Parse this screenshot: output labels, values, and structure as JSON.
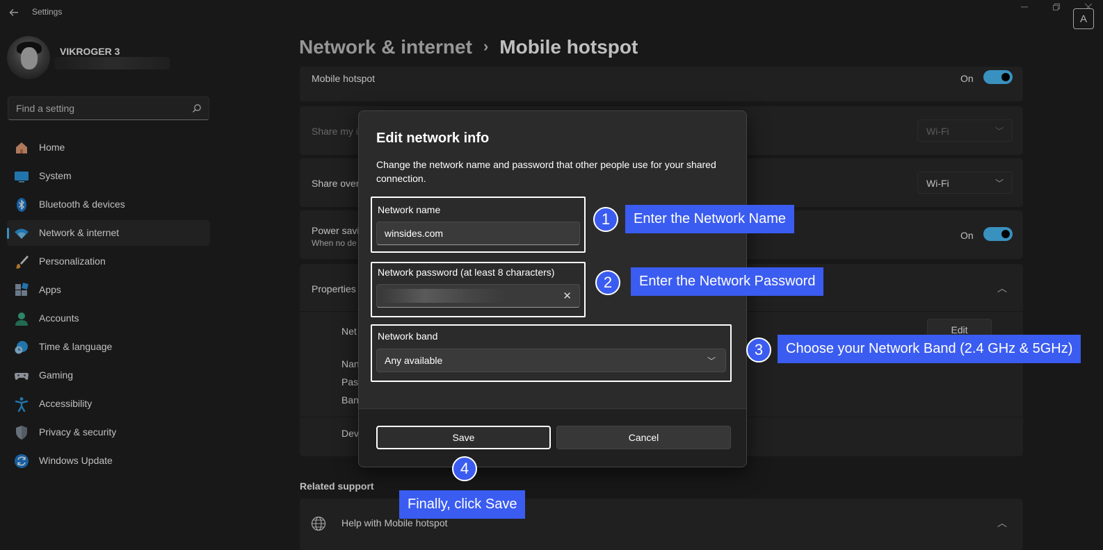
{
  "window": {
    "title": "Settings",
    "ocr_icon_label": "A"
  },
  "user": {
    "name": "VIKROGER 3"
  },
  "search": {
    "placeholder": "Find a setting"
  },
  "sidebar": {
    "items": [
      {
        "label": "Home",
        "icon": "home-icon"
      },
      {
        "label": "System",
        "icon": "system-icon"
      },
      {
        "label": "Bluetooth & devices",
        "icon": "bluetooth-icon"
      },
      {
        "label": "Network & internet",
        "icon": "wifi-icon",
        "active": true
      },
      {
        "label": "Personalization",
        "icon": "brush-icon"
      },
      {
        "label": "Apps",
        "icon": "apps-icon"
      },
      {
        "label": "Accounts",
        "icon": "accounts-icon"
      },
      {
        "label": "Time & language",
        "icon": "globe-clock-icon"
      },
      {
        "label": "Gaming",
        "icon": "gamepad-icon"
      },
      {
        "label": "Accessibility",
        "icon": "accessibility-icon"
      },
      {
        "label": "Privacy & security",
        "icon": "shield-icon"
      },
      {
        "label": "Windows Update",
        "icon": "update-icon"
      }
    ]
  },
  "breadcrumb": {
    "parent": "Network & internet",
    "separator": "›",
    "current": "Mobile hotspot"
  },
  "main": {
    "hotspot": {
      "label": "Mobile hotspot",
      "state": "On"
    },
    "share_from": {
      "label": "Share my i",
      "value": "Wi-Fi"
    },
    "share_over": {
      "label": "Share over",
      "value": "Wi-Fi"
    },
    "power_saving": {
      "label": "Power savi",
      "sub": "When no de",
      "state": "On"
    },
    "properties": {
      "label": "Properties",
      "network_row": "Net",
      "edit_label": "Edit",
      "name_row": "Nan",
      "password_row": "Pas",
      "band_row": "Ban",
      "devices_row": "Dev"
    },
    "related_support": {
      "title": "Related support",
      "help_label": "Help with Mobile hotspot"
    }
  },
  "dialog": {
    "title": "Edit network info",
    "description": "Change the network name and password that other people use for your shared connection.",
    "network_name_label": "Network name",
    "network_name_value": "winsides.com",
    "password_label": "Network password (at least 8 characters)",
    "band_label": "Network band",
    "band_value": "Any available",
    "save_label": "Save",
    "cancel_label": "Cancel"
  },
  "annotations": [
    {
      "number": "1",
      "text": "Enter the Network Name"
    },
    {
      "number": "2",
      "text": "Enter the Network Password"
    },
    {
      "number": "3",
      "text": "Choose your Network Band (2.4 GHz & 5GHz)"
    },
    {
      "number": "4",
      "text": "Finally, click Save"
    }
  ],
  "colors": {
    "background": "#202020",
    "card": "#2b2b2b",
    "accent": "#4cc2ff",
    "annotation": "#3b5cf0"
  }
}
